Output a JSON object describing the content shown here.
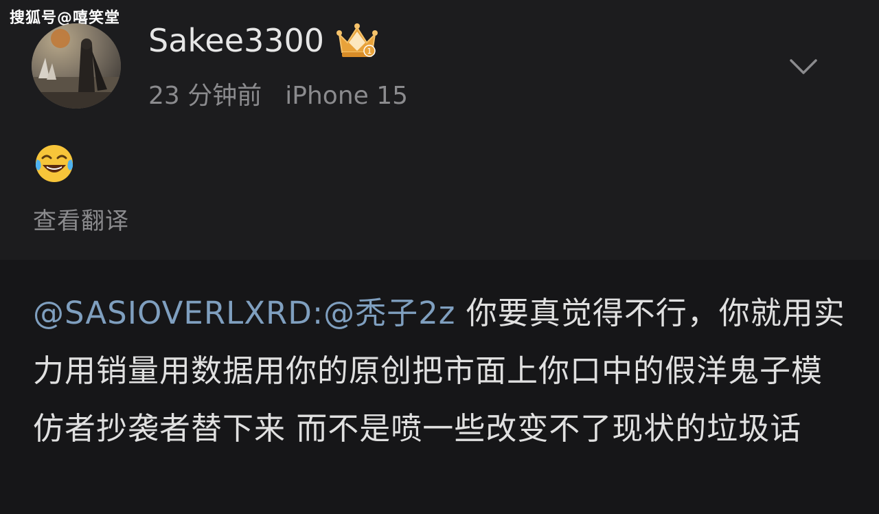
{
  "watermark": "搜狐号@嘻笑堂",
  "post": {
    "username": "Sakee3300",
    "badge_icon": "crown-badge-icon",
    "time_ago": "23 分钟前",
    "device": "iPhone 15",
    "emoji_icon": "laughing-tears-emoji-icon",
    "translate_label": "查看翻译"
  },
  "reply": {
    "mention_1": "@SASIOVERLXRD",
    "separator": ":",
    "mention_2": "@秃子2z",
    "body": " 你要真觉得不行，你就用实力用销量用数据用你的原创把市面上你口中的假洋鬼子模仿者抄袭者替下来 而不是喷一些改变不了现状的垃圾话"
  },
  "colors": {
    "background": "#1c1c1e",
    "text": "#e0e0e0",
    "muted": "#8b8b8e",
    "mention": "#7f9fbf",
    "crown": "#e8a23a"
  }
}
